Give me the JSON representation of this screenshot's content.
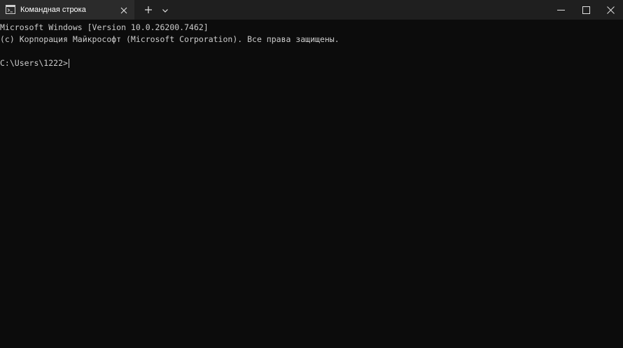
{
  "tab": {
    "icon": "terminal-icon",
    "title": "Командная строка",
    "close_icon": "close-icon"
  },
  "tabbar": {
    "new_tab_icon": "plus-icon",
    "dropdown_icon": "chevron-down-icon"
  },
  "window_controls": {
    "minimize_icon": "minimize-icon",
    "maximize_icon": "maximize-icon",
    "close_icon": "close-icon"
  },
  "terminal": {
    "lines": [
      "Microsoft Windows [Version 10.0.26200.7462]",
      "(c) Корпорация Майкрософт (Microsoft Corporation). Все права защищены.",
      ""
    ],
    "prompt": "C:\\Users\\1222>"
  },
  "colors": {
    "background": "#0c0c0c",
    "titlebar": "#1f1f1f",
    "active_tab": "#2b2b2b",
    "text": "#cccccc"
  }
}
